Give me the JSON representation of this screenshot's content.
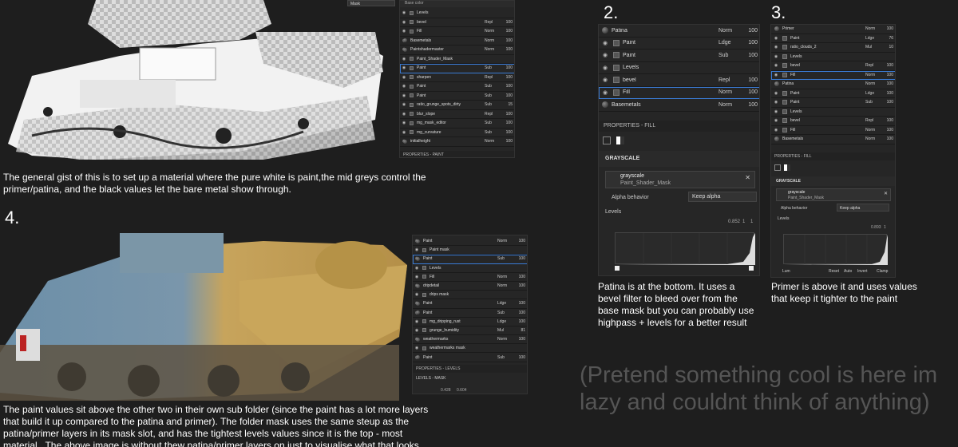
{
  "sections": {
    "s1_number": "1.",
    "s1_caption": "The general gist of this is to set up a material where the pure white is paint,the mid greys control the primer/patina, and the black values let the bare metal show through.",
    "s4_number": "4.",
    "s4_caption": "The paint values sit above the other two in their own sub folder (since the paint has a lot more layers that build it up compared to the patina and primer). The folder mask uses the same steup as the patina/primer layers in its mask slot, and has the tightest levels values since it is the top - most material.. The above image is without thew patina/primer layers on just to visualise what that looks like.",
    "s2_number": "2.",
    "s2_caption": "Patina is at the bottom. It uses a bevel filter to bleed over from the base mask but you can probably use highpass + levels for a better result",
    "s3_number": "3.",
    "s3_caption": "Primer is above it and uses values that keep it tighter to the paint",
    "placeholder": "(Pretend something cool is here im lazy and couldnt think of anything)"
  },
  "panel1": {
    "top_dropdown": "Mask",
    "top_label": "Base color",
    "rows": [
      {
        "name": "Levels",
        "blend": "",
        "op": ""
      },
      {
        "name": "bevel",
        "blend": "Repl",
        "op": "100"
      },
      {
        "name": "Fill",
        "blend": "Norm",
        "op": "100"
      },
      {
        "name": "Basemetals",
        "blend": "Norm",
        "op": "100"
      },
      {
        "name": "Paintshadermaster",
        "blend": "Norm",
        "op": "100"
      },
      {
        "name": "Paint_Shader_Mask",
        "blend": "",
        "op": ""
      },
      {
        "name": "Paint",
        "blend": "Sub",
        "op": "100"
      },
      {
        "name": "sharpen",
        "blend": "Repl",
        "op": "100"
      },
      {
        "name": "Paint",
        "blend": "Sub",
        "op": "100"
      },
      {
        "name": "Paint",
        "blend": "Sub",
        "op": "100"
      },
      {
        "name": "ratio_grunge_spots_dirty",
        "blend": "Sub",
        "op": "15"
      },
      {
        "name": "blur_slope",
        "blend": "Repl",
        "op": "100"
      },
      {
        "name": "mg_mask_editor",
        "blend": "Sub",
        "op": "100"
      },
      {
        "name": "mg_curvature",
        "blend": "Sub",
        "op": "100"
      },
      {
        "name": "initialheight",
        "blend": "Norm",
        "op": "100"
      }
    ],
    "footer": "PROPERTIES - PAINT"
  },
  "panel2": {
    "rows": [
      {
        "name": "Patina",
        "blend": "Norm",
        "op": "100"
      },
      {
        "name": "Paint",
        "blend": "Ldge",
        "op": "100"
      },
      {
        "name": "Paint",
        "blend": "Sub",
        "op": "100"
      },
      {
        "name": "Levels",
        "blend": "",
        "op": ""
      },
      {
        "name": "bevel",
        "blend": "Repl",
        "op": "100"
      },
      {
        "name": "Fill",
        "blend": "Norm",
        "op": "100"
      },
      {
        "name": "Basemetals",
        "blend": "Norm",
        "op": "100"
      }
    ],
    "props_title": "PROPERTIES - FILL",
    "grayscale_title": "GRAYSCALE",
    "grayscale_name": "grayscale",
    "grayscale_sub": "Paint_Shader_Mask",
    "alpha_label": "Alpha behavior",
    "alpha_value": "Keep alpha",
    "levels_label": "Levels",
    "levels_values": [
      "0.852",
      "1",
      "1"
    ]
  },
  "panel3": {
    "rows": [
      {
        "name": "Primer",
        "blend": "Norm",
        "op": "100"
      },
      {
        "name": "Paint",
        "blend": "Ldge",
        "op": "76"
      },
      {
        "name": "ratio_clouds_2",
        "blend": "Mul",
        "op": "10"
      },
      {
        "name": "Levels",
        "blend": "",
        "op": ""
      },
      {
        "name": "bevel",
        "blend": "Repl",
        "op": "100"
      },
      {
        "name": "Fill",
        "blend": "Norm",
        "op": "100"
      },
      {
        "name": "Patina",
        "blend": "Norm",
        "op": "100"
      },
      {
        "name": "Paint",
        "blend": "Ldge",
        "op": "100"
      },
      {
        "name": "Paint",
        "blend": "Sub",
        "op": "100"
      },
      {
        "name": "Levels",
        "blend": "",
        "op": ""
      },
      {
        "name": "bevel",
        "blend": "Repl",
        "op": "100"
      },
      {
        "name": "Fill",
        "blend": "Norm",
        "op": "100"
      },
      {
        "name": "Basemetals",
        "blend": "Norm",
        "op": "100"
      }
    ],
    "props_title": "PROPERTIES - FILL",
    "grayscale_title": "GRAYSCALE",
    "grayscale_name": "grayscale",
    "grayscale_sub": "Paint_Shader_Mask",
    "alpha_label": "Alpha behavior",
    "alpha_value": "Keep alpha",
    "levels_label": "Levels",
    "levels_values": [
      "0.893",
      "1"
    ],
    "buttons": [
      "Reset",
      "Auto",
      "Invert",
      "Clamp"
    ],
    "channel": "Lum"
  },
  "panel4": {
    "rows": [
      {
        "name": "Paint",
        "blend": "Norm",
        "op": "100"
      },
      {
        "name": "Paint mask",
        "blend": "",
        "op": ""
      },
      {
        "name": "Paint",
        "blend": "Sub",
        "op": "100"
      },
      {
        "name": "Levels",
        "blend": "",
        "op": ""
      },
      {
        "name": "Fill",
        "blend": "Norm",
        "op": "100"
      },
      {
        "name": "dripdetail",
        "blend": "Norm",
        "op": "100"
      },
      {
        "name": "drips mask",
        "blend": "",
        "op": ""
      },
      {
        "name": "Paint",
        "blend": "Ldge",
        "op": "100"
      },
      {
        "name": "Paint",
        "blend": "Sub",
        "op": "100"
      },
      {
        "name": "mg_dripping_rust",
        "blend": "Ldge",
        "op": "100"
      },
      {
        "name": "grunge_humidity",
        "blend": "Mul",
        "op": "81"
      },
      {
        "name": "weathermarks",
        "blend": "Norm",
        "op": "100"
      },
      {
        "name": "weathermarks mask",
        "blend": "",
        "op": ""
      },
      {
        "name": "Paint",
        "blend": "Sub",
        "op": "100"
      }
    ],
    "props_title": "PROPERTIES - LEVELS",
    "levels_mask": "LEVELS - MASK",
    "levels_values": [
      "0.428",
      "0.604"
    ]
  },
  "colors": {
    "background": "#1e1e1e",
    "panel": "#262626",
    "selection": "#3a7bd5",
    "placeholder_text": "#555555"
  }
}
